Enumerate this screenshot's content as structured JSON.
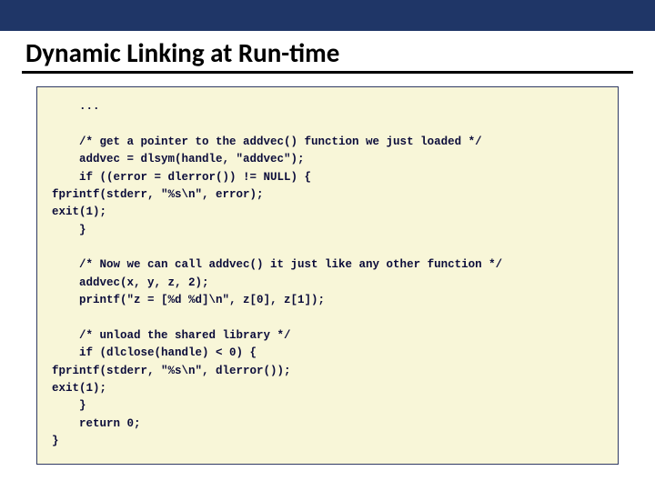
{
  "title": "Dynamic Linking at Run-time",
  "code": "    ...\n\n    /* get a pointer to the addvec() function we just loaded */\n    addvec = dlsym(handle, \"addvec\");\n    if ((error = dlerror()) != NULL) {\nfprintf(stderr, \"%s\\n\", error);\nexit(1);\n    }\n\n    /* Now we can call addvec() it just like any other function */\n    addvec(x, y, z, 2);\n    printf(\"z = [%d %d]\\n\", z[0], z[1]);\n\n    /* unload the shared library */\n    if (dlclose(handle) < 0) {\nfprintf(stderr, \"%s\\n\", dlerror());\nexit(1);\n    }\n    return 0;\n}"
}
